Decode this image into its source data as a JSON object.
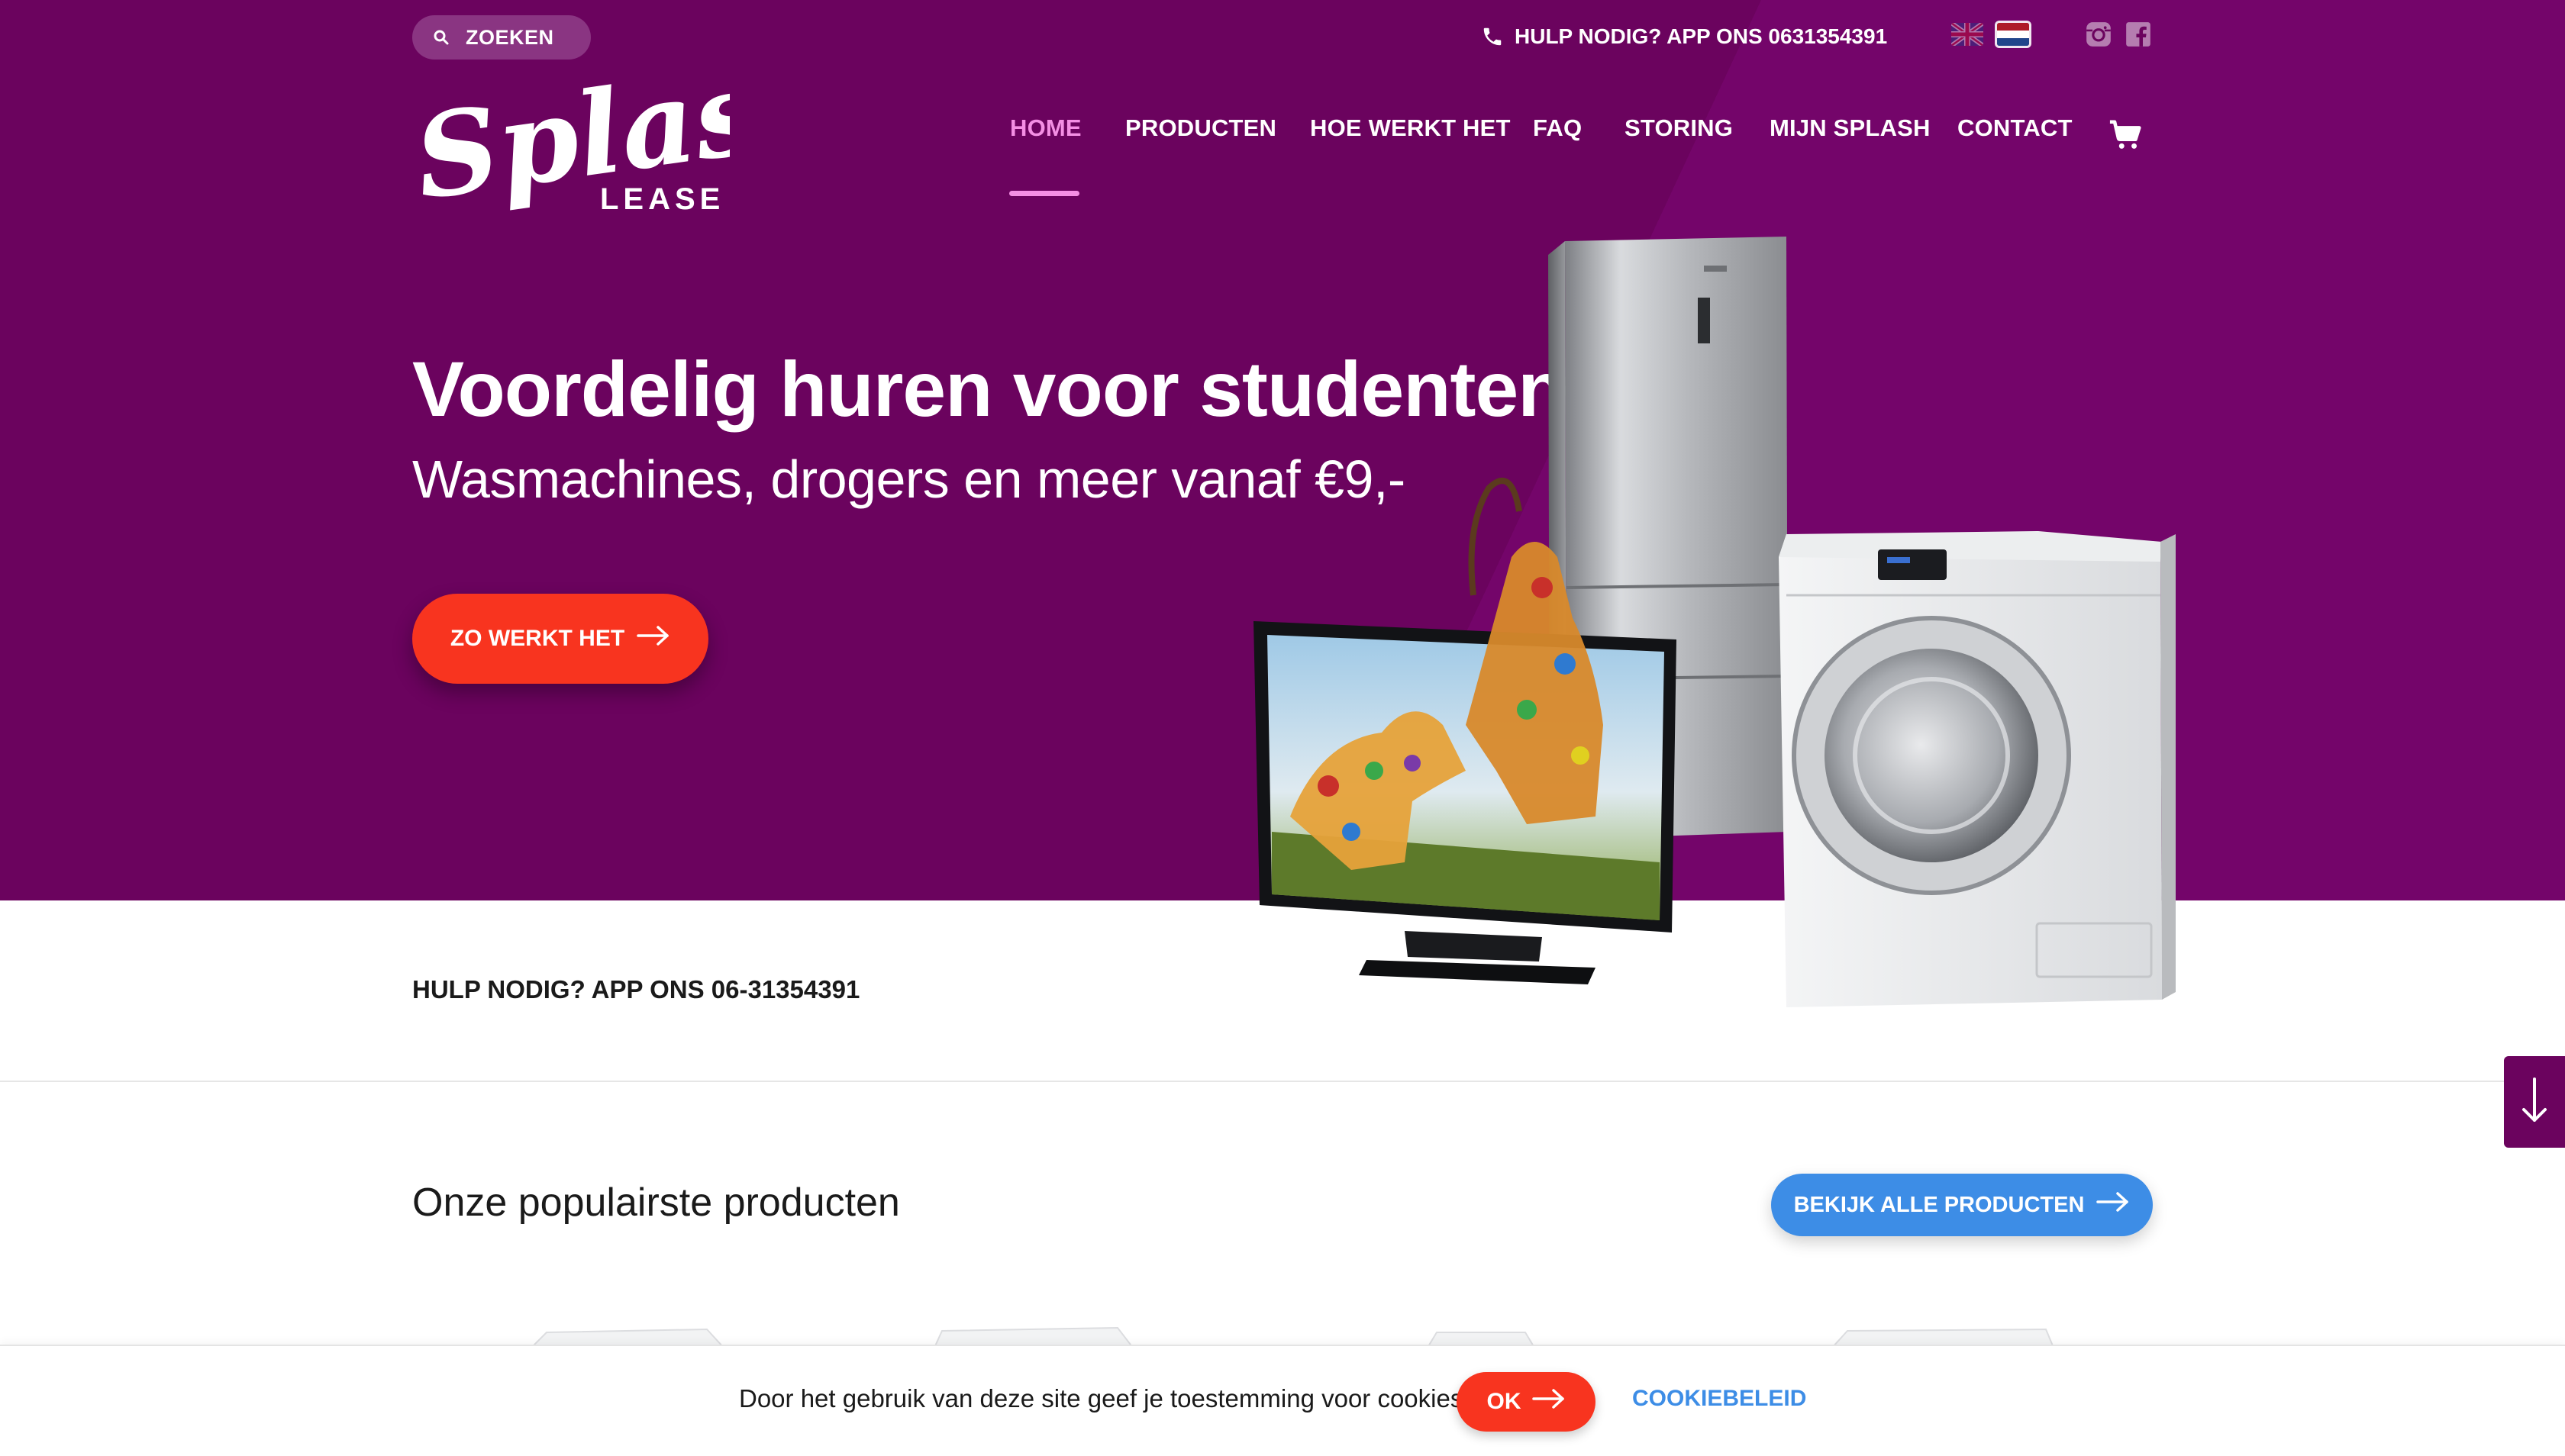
{
  "search": {
    "label": "ZOEKEN",
    "icon": "search-icon"
  },
  "top_help": {
    "text": "HULP NODIG? APP ONS 0631354391",
    "icon": "phone-icon"
  },
  "languages": [
    {
      "code": "en",
      "icon": "uk-flag-icon"
    },
    {
      "code": "nl",
      "icon": "nl-flag-icon",
      "selected": true
    }
  ],
  "social": [
    {
      "name": "instagram",
      "icon": "instagram-icon"
    },
    {
      "name": "facebook",
      "icon": "facebook-icon"
    }
  ],
  "logo": {
    "script": "Splash",
    "sub": "LEASE"
  },
  "nav": {
    "items": [
      {
        "label": "HOME",
        "active": true
      },
      {
        "label": "PRODUCTEN"
      },
      {
        "label": "HOE WERKT HET"
      },
      {
        "label": "FAQ"
      },
      {
        "label": "STORING"
      },
      {
        "label": "MIJN SPLASH"
      },
      {
        "label": "CONTACT"
      }
    ],
    "cart_icon": "cart-icon"
  },
  "hero": {
    "title": "Voordelig huren voor studenten",
    "subtitle": "Wasmachines, drogers en meer vanaf €9,-",
    "cta_label": "ZO WERKT HET",
    "appliances": [
      "fridge",
      "tv",
      "washing-machine"
    ]
  },
  "help_strip": {
    "text": "HULP NODIG? APP ONS 06-31354391"
  },
  "scroll_icon": "arrow-down-icon",
  "products": {
    "title": "Onze populairste producten",
    "all_label": "BEKIJK ALLE PRODUCTEN"
  },
  "cookie": {
    "text": "Door het gebruik van deze site geef je toestemming voor cookies.",
    "ok_label": "OK",
    "policy_label": "COOKIEBELEID"
  },
  "colors": {
    "hero_bg": "#6b035e",
    "accent_pink": "#f48fe4",
    "cta_red": "#f8341f",
    "link_blue": "#3d8de6"
  }
}
